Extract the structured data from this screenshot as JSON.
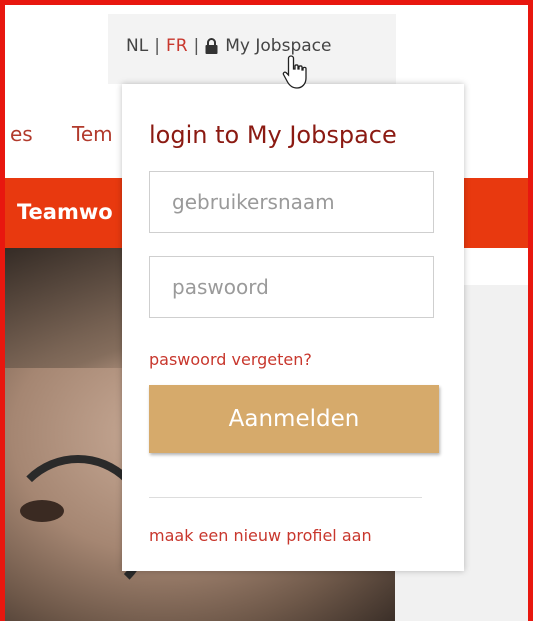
{
  "topbar": {
    "lang_nl": "NL",
    "separator": "|",
    "lang_fr": "FR",
    "my_jobspace": "My Jobspace",
    "lock_icon": "lock-icon"
  },
  "nav": {
    "item_partial_1": "es",
    "item_partial_2": "Tem"
  },
  "banner": {
    "text_partial": "Teamwo"
  },
  "login": {
    "title": "login to My Jobspace",
    "username_placeholder": "gebruikersnaam",
    "password_placeholder": "paswoord",
    "forgot_link": "paswoord vergeten?",
    "submit_label": "Aanmelden",
    "new_profile_link": "maak een nieuw profiel aan"
  },
  "colors": {
    "brand_red": "#e8390f",
    "link_red": "#c8372d",
    "title_dark_red": "#8b1a12",
    "button_gold": "#d6aa6b"
  }
}
